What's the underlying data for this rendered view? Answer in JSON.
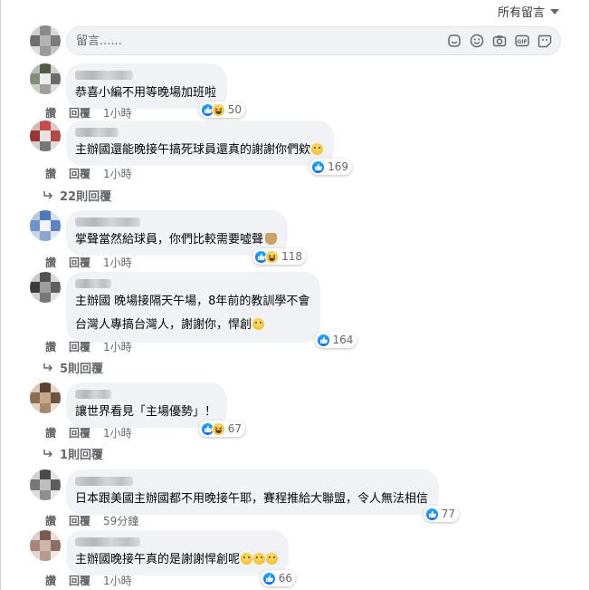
{
  "sort": {
    "label": "所有留言"
  },
  "composer": {
    "placeholder": "留言......",
    "tools": [
      "sticker-icon",
      "emoji-icon",
      "camera-icon",
      "gif-icon",
      "avatar-sticker-icon"
    ]
  },
  "action_labels": {
    "like": "讚",
    "reply": "回覆"
  },
  "comments": [
    {
      "text": [
        "恭喜小編不用等晚場加班啦"
      ],
      "time": "1小時",
      "reactions": {
        "types": [
          "like",
          "haha"
        ],
        "count": "50"
      }
    },
    {
      "text": [
        "主辦國還能晚接午搞死球員還真的謝謝你們欸"
      ],
      "time": "1小時",
      "reactions": {
        "types": [
          "like"
        ],
        "count": "169"
      },
      "replies": "22則回覆"
    },
    {
      "text": [
        "掌聲當然給球員，你們比較需要噓聲"
      ],
      "time": "1小時",
      "reactions": {
        "types": [
          "like",
          "haha"
        ],
        "count": "118"
      }
    },
    {
      "text": [
        "主辦國 晚場接隔天午場，8年前的教訓學不會",
        "台灣人專搞台灣人，謝謝你，悍創"
      ],
      "time": "1小時",
      "reactions": {
        "types": [
          "like"
        ],
        "count": "164"
      },
      "replies": "5則回覆"
    },
    {
      "text": [
        "讓世界看見「主場優勢」！"
      ],
      "time": "1小時",
      "reactions": {
        "types": [
          "like",
          "haha"
        ],
        "count": "67"
      },
      "replies": "1則回覆"
    },
    {
      "text": [
        "日本跟美國主辦國都不用晚接午耶，賽程推給大聯盟，令人無法相信"
      ],
      "time": "59分鐘",
      "reactions": {
        "types": [
          "like"
        ],
        "count": "77"
      }
    },
    {
      "text": [
        "主辦國晚接午真的是謝謝悍創呢"
      ],
      "time": "1小時",
      "reactions": {
        "types": [
          "like"
        ],
        "count": "66"
      }
    }
  ],
  "colors": {
    "like": "#0866ff",
    "bubble": "#f0f2f5",
    "meta": "#65676b"
  }
}
